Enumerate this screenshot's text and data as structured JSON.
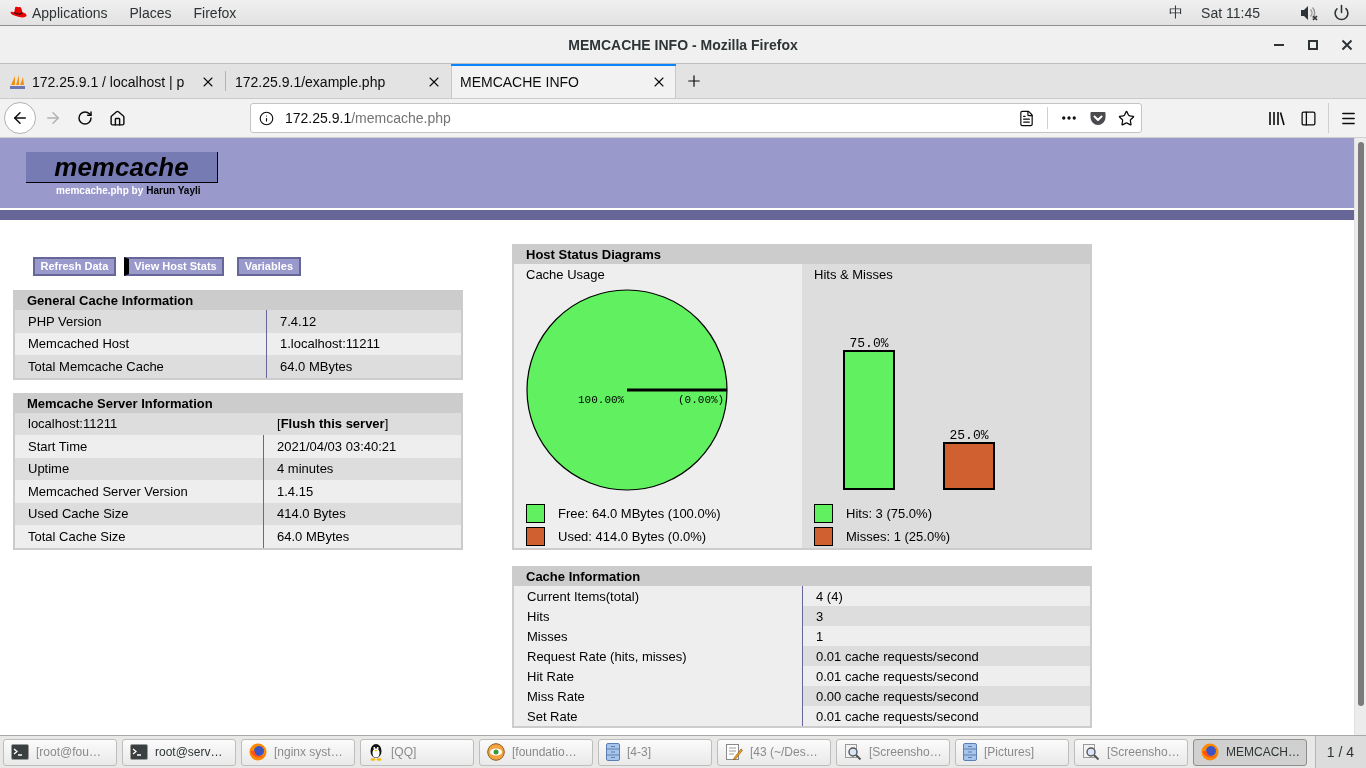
{
  "top_bar": {
    "menus": [
      "Applications",
      "Places",
      "Firefox"
    ],
    "input_method": "中",
    "clock": "Sat 11:45"
  },
  "window": {
    "title": "MEMCACHE INFO - Mozilla Firefox"
  },
  "tabs": [
    {
      "title": "172.25.9.1 / localhost | p",
      "selected": false,
      "favicon": true
    },
    {
      "title": "172.25.9.1/example.php",
      "selected": false,
      "favicon": false
    },
    {
      "title": "MEMCACHE INFO",
      "selected": true,
      "favicon": false
    }
  ],
  "navigation": {
    "forward_disabled": true
  },
  "address_bar": {
    "host": "172.25.9.1",
    "path": "/memcache.php"
  },
  "page": {
    "logo": "memcache",
    "byline": "memcache.php by",
    "author": "Harun Yayli",
    "menu": [
      {
        "label": "Refresh Data",
        "selected": false
      },
      {
        "label": "View Host Stats",
        "selected": true
      },
      {
        "label": "Variables",
        "selected": false
      }
    ],
    "general_info": {
      "title": "General Cache Information",
      "rows": [
        {
          "label": "PHP Version",
          "value": "7.4.12"
        },
        {
          "label": "Memcached Host",
          "value": "1.localhost:11211"
        },
        {
          "label": "Total Memcache Cache",
          "value": "64.0 MBytes"
        }
      ]
    },
    "server_info": {
      "title": "Memcache Server Information",
      "server": "localhost:11211",
      "flush_link": "[**Flush this server**]",
      "rows": [
        {
          "label": "Start Time",
          "value": "2021/04/03 03:40:21"
        },
        {
          "label": "Uptime",
          "value": "4 minutes"
        },
        {
          "label": "Memcached Server Version",
          "value": "1.4.15"
        },
        {
          "label": "Used Cache Size",
          "value": "414.0 Bytes"
        },
        {
          "label": "Total Cache Size",
          "value": "64.0 MBytes"
        }
      ]
    },
    "diagrams": {
      "title": "Host Status Diagrams",
      "panels": [
        {
          "title": "Cache Usage",
          "chart_data": {
            "type": "pie",
            "values": [
              100,
              0
            ],
            "colors": [
              "#60f060",
              "#d06030"
            ],
            "value_labels": [
              "100.00%",
              "(0.00%)"
            ]
          },
          "legend": [
            {
              "label": "Free: 64.0 MBytes (100.0%)",
              "color": "#60f060"
            },
            {
              "label": "Used: 414.0 Bytes (0.0%)",
              "color": "#d06030"
            }
          ]
        },
        {
          "title": "Hits & Misses",
          "chart_data": {
            "type": "bar",
            "categories": [
              null,
              null
            ],
            "values": [
              75,
              25
            ],
            "colors": [
              "#60f060",
              "#d06030"
            ],
            "value_labels": [
              "75.0%",
              "25.0%"
            ]
          },
          "legend": [
            {
              "label": "Hits: 3 (75.0%)",
              "color": "#60f060"
            },
            {
              "label": "Misses: 1 (25.0%)",
              "color": "#d06030"
            }
          ]
        }
      ]
    },
    "cache_info": {
      "title": "Cache Information",
      "rows": [
        {
          "label": "Current Items(total)",
          "value": "4 (4)"
        },
        {
          "label": "Hits",
          "value": "3"
        },
        {
          "label": "Misses",
          "value": "1"
        },
        {
          "label": "Request Rate (hits, misses)",
          "value": "0.01 cache requests/second"
        },
        {
          "label": "Hit Rate",
          "value": "0.01 cache requests/second"
        },
        {
          "label": "Miss Rate",
          "value": "0.00 cache requests/second"
        },
        {
          "label": "Set Rate",
          "value": "0.01 cache requests/second"
        }
      ]
    }
  },
  "taskbar": {
    "items": [
      {
        "label": "[root@fou…",
        "kind": "terminal",
        "minimized": true,
        "selected": false
      },
      {
        "label": "root@serv…",
        "kind": "terminal",
        "minimized": false,
        "selected": false
      },
      {
        "label": "[nginx syst…",
        "kind": "globe",
        "minimized": true,
        "selected": false
      },
      {
        "label": "[QQ]",
        "kind": "penguin",
        "minimized": true,
        "selected": false
      },
      {
        "label": "[foundatio…",
        "kind": "eye",
        "minimized": true,
        "selected": false
      },
      {
        "label": "[4-3]",
        "kind": "cabinet",
        "minimized": true,
        "selected": false
      },
      {
        "label": "[43 (~/Des…",
        "kind": "notepad",
        "minimized": true,
        "selected": false
      },
      {
        "label": "[Screensho…",
        "kind": "magnifier",
        "minimized": true,
        "selected": false
      },
      {
        "label": "[Pictures]",
        "kind": "cabinet",
        "minimized": true,
        "selected": false
      },
      {
        "label": "[Screensho…",
        "kind": "magnifier",
        "minimized": true,
        "selected": false
      },
      {
        "label": "MEMCACH…",
        "kind": "globe",
        "minimized": false,
        "selected": true
      }
    ],
    "workspace": "1 / 4"
  }
}
